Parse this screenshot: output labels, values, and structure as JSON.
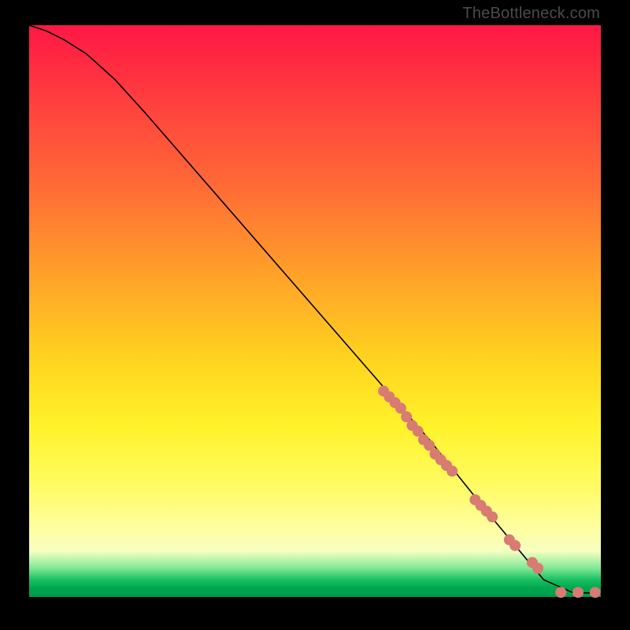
{
  "watermark": "TheBottleneck.com",
  "colors": {
    "marker": "#d77b73",
    "line": "#000000"
  },
  "chart_data": {
    "type": "line",
    "title": "",
    "xlabel": "",
    "ylabel": "",
    "xlim": [
      0,
      100
    ],
    "ylim": [
      0,
      100
    ],
    "grid": false,
    "line": {
      "x": [
        0,
        3,
        6,
        10,
        15,
        20,
        30,
        40,
        50,
        60,
        70,
        80,
        85,
        90,
        95,
        100
      ],
      "y": [
        100,
        99,
        97.5,
        95,
        90.5,
        85,
        73.5,
        62,
        50.5,
        39,
        27.5,
        15,
        9,
        3,
        0.8,
        0.6
      ]
    },
    "markers": {
      "comment": "salmon-colored scatter points clustered along the lower-right of the curve and along the bottom edge",
      "x": [
        62,
        63,
        64,
        65,
        66,
        67,
        68,
        69,
        70,
        71,
        72,
        73,
        74,
        78,
        79,
        80,
        81,
        84,
        85,
        88,
        89,
        93,
        96,
        99
      ],
      "y": [
        36,
        35,
        34,
        33,
        31.5,
        30,
        29,
        27.5,
        26.5,
        25,
        24,
        23,
        22,
        17,
        16,
        15,
        14,
        10,
        9,
        6,
        5,
        0.8,
        0.8,
        0.8
      ]
    }
  }
}
